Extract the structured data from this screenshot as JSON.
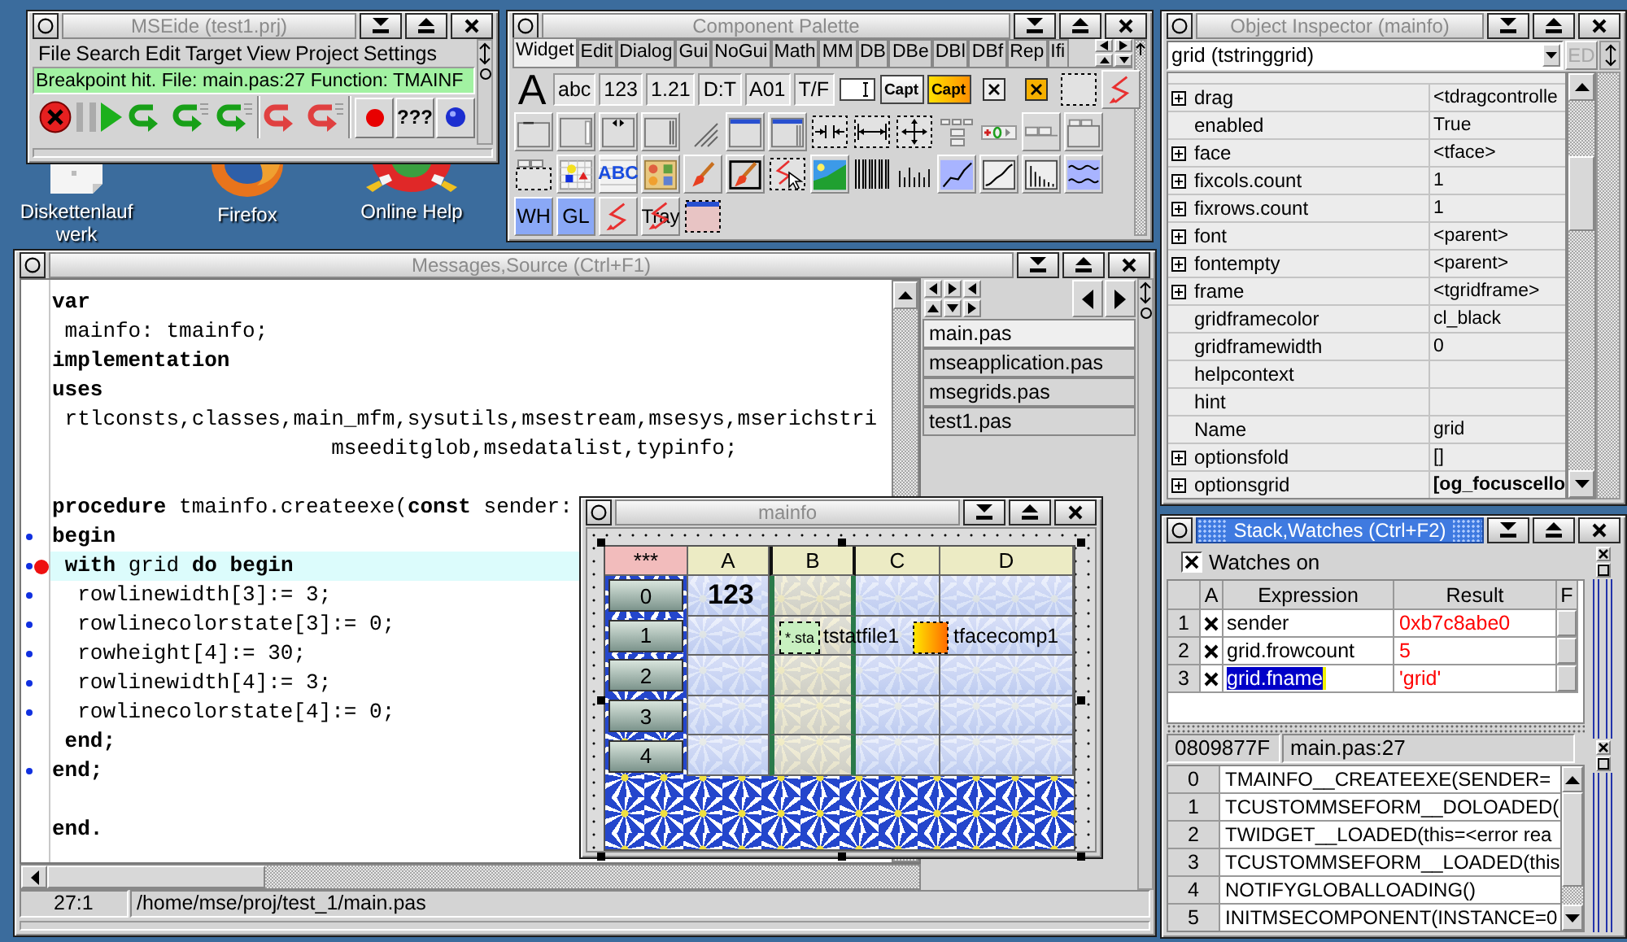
{
  "desktop_icons": [
    {
      "kind": "floppy",
      "label": "Diskettenlaufwerk"
    },
    {
      "kind": "browser",
      "label": "Firefox"
    },
    {
      "kind": "help",
      "label": "Online Help"
    }
  ],
  "ide_window": {
    "title": "MSEide (test1.prj)",
    "active": false,
    "menu": [
      "File",
      "Search",
      "Edit",
      "Target",
      "View",
      "Project",
      "Settings"
    ],
    "status": "Breakpoint hit. File: main.pas:27 Function: TMAINF",
    "toolbar_groups": [
      {
        "kind": "plain",
        "buttons": [
          {
            "kind": "stop",
            "disabled": false
          },
          {
            "kind": "pause",
            "disabled": true
          },
          {
            "kind": "run",
            "disabled": false
          },
          {
            "kind": "next",
            "disabled": false
          },
          {
            "kind": "step",
            "disabled": false
          },
          {
            "kind": "finish",
            "disabled": false
          }
        ]
      },
      {
        "kind": "plain",
        "buttons": [
          {
            "kind": "back",
            "disabled": false
          },
          {
            "kind": "reset",
            "disabled": false
          }
        ]
      },
      {
        "kind": "boxed",
        "buttons": [
          {
            "kind": "dot",
            "disabled": false
          },
          {
            "kind": "text",
            "label": "???",
            "disabled": false
          },
          {
            "kind": "ball",
            "disabled": false
          }
        ]
      }
    ]
  },
  "palette_window": {
    "title": "Component Palette",
    "active": false,
    "tabs": [
      {
        "label": "Widget",
        "selected": true
      },
      {
        "label": "Edit",
        "selected": false
      },
      {
        "label": "Dialog",
        "selected": false
      },
      {
        "label": "Gui",
        "selected": false
      },
      {
        "label": "NoGui",
        "selected": false
      },
      {
        "label": "Math",
        "selected": false
      },
      {
        "label": "MM",
        "selected": false
      },
      {
        "label": "DB",
        "selected": false
      },
      {
        "label": "DBe",
        "selected": false
      },
      {
        "label": "DBl",
        "selected": false
      },
      {
        "label": "DBf",
        "selected": false
      },
      {
        "label": "Rep",
        "selected": false
      },
      {
        "label": "Ifi",
        "selected": false
      }
    ],
    "component_rows": [
      [
        {
          "kind": "letter",
          "label": "A"
        },
        {
          "kind": "text",
          "label": "abc"
        },
        {
          "kind": "text",
          "label": "123"
        },
        {
          "kind": "text",
          "label": "1.21"
        },
        {
          "kind": "text",
          "label": "D:T"
        },
        {
          "kind": "text",
          "label": "A01"
        },
        {
          "kind": "text",
          "label": "T/F"
        },
        {
          "kind": "edit"
        },
        {
          "kind": "button",
          "label": "Capt"
        },
        {
          "kind": "buttoncolored",
          "label": "Capt"
        },
        {
          "kind": "check"
        },
        {
          "kind": "checkcolored"
        },
        {
          "kind": "dashed"
        },
        {
          "kind": "lightning"
        }
      ],
      [
        {
          "kind": "groupbox"
        },
        {
          "kind": "scrollbox"
        },
        {
          "kind": "splitter"
        },
        {
          "kind": "scrollbar"
        },
        {
          "kind": "sizegrip"
        },
        {
          "kind": "form"
        },
        {
          "kind": "scrollform"
        },
        {
          "kind": "spacer"
        },
        {
          "kind": "stretch"
        },
        {
          "kind": "layout"
        },
        {
          "kind": "buttons"
        },
        {
          "kind": "stepper"
        },
        {
          "kind": "tabbar"
        },
        {
          "kind": "tabwidget"
        }
      ],
      [
        {
          "kind": "dashedtabs"
        },
        {
          "kind": "shapesgrid"
        },
        {
          "kind": "textgrid",
          "label": "ABC"
        },
        {
          "kind": "apptiles"
        },
        {
          "kind": "brush"
        },
        {
          "kind": "framedbrush"
        },
        {
          "kind": "pointer"
        },
        {
          "kind": "landscape"
        },
        {
          "kind": "barcode"
        },
        {
          "kind": "ticks"
        },
        {
          "kind": "linechart"
        },
        {
          "kind": "curve"
        },
        {
          "kind": "barchart"
        },
        {
          "kind": "waves"
        }
      ],
      [
        {
          "kind": "tile",
          "label": "WH"
        },
        {
          "kind": "tile",
          "label": "GL"
        },
        {
          "kind": "lightning"
        },
        {
          "kind": "tray",
          "label": "Tray"
        },
        {
          "kind": "pinkform"
        }
      ]
    ]
  },
  "inspector_window": {
    "title": "Object Inspector (mainfo)",
    "active": false,
    "selector": "grid (tstringgrid)",
    "editor_button": {
      "label": "ED",
      "disabled": true
    },
    "rows": [
      {
        "name": "drag",
        "value": "<tdragcontrolle",
        "expandable": true,
        "modified": false
      },
      {
        "name": "enabled",
        "value": "True",
        "expandable": false,
        "modified": false
      },
      {
        "name": "face",
        "value": "<tface>",
        "expandable": true,
        "modified": false
      },
      {
        "name": "fixcols.count",
        "value": "1",
        "expandable": true,
        "modified": false
      },
      {
        "name": "fixrows.count",
        "value": "1",
        "expandable": true,
        "modified": false
      },
      {
        "name": "font",
        "value": "<parent>",
        "expandable": true,
        "modified": false
      },
      {
        "name": "fontempty",
        "value": "<parent>",
        "expandable": true,
        "modified": false
      },
      {
        "name": "frame",
        "value": "<tgridframe>",
        "expandable": true,
        "modified": false
      },
      {
        "name": "gridframecolor",
        "value": "cl_black",
        "expandable": false,
        "modified": false
      },
      {
        "name": "gridframewidth",
        "value": "0",
        "expandable": false,
        "modified": false
      },
      {
        "name": "helpcontext",
        "expandable": false,
        "modified": false
      },
      {
        "name": "hint",
        "expandable": false,
        "modified": false
      },
      {
        "name": "Name",
        "value": "grid",
        "expandable": false,
        "modified": false
      },
      {
        "name": "optionsfold",
        "value": "[]",
        "expandable": true,
        "modified": false
      },
      {
        "name": "optionsgrid",
        "value": "[og_focuscello",
        "expandable": true,
        "modified": true
      }
    ]
  },
  "source_window": {
    "title": "Messages,Source (Ctrl+F1)",
    "active": false,
    "lines": [
      {
        "kind": "code",
        "text": "var",
        "bold": true,
        "executable": false,
        "breakpoint": false,
        "current": false
      },
      {
        "kind": "code",
        "text": " mainfo: tmainfo;",
        "bold": false,
        "executable": false,
        "breakpoint": false,
        "current": false
      },
      {
        "kind": "code",
        "text": "implementation",
        "bold": true,
        "executable": false,
        "breakpoint": false,
        "current": false
      },
      {
        "kind": "code",
        "text": "uses",
        "bold": true,
        "executable": false,
        "breakpoint": false,
        "current": false
      },
      {
        "kind": "code",
        "text": " rtlconsts,classes,main_mfm,sysutils,msestream,msesys,mserichstri",
        "bold": false,
        "executable": false,
        "breakpoint": false,
        "current": false
      },
      {
        "kind": "code",
        "text": "                      mseeditglob,msedatalist,typinfo;",
        "bold": false,
        "executable": false,
        "breakpoint": false,
        "current": false
      },
      {
        "kind": "blank",
        "executable": false,
        "breakpoint": false,
        "current": false
      },
      {
        "kind": "code",
        "text": "**procedure** tmainfo.createexe(**const** sender:",
        "bold": false,
        "executable": false,
        "breakpoint": false,
        "current": false
      },
      {
        "kind": "code",
        "text": "begin",
        "bold": true,
        "executable": true,
        "breakpoint": false,
        "current": false
      },
      {
        "kind": "code",
        "text": " **with** grid **do** **begin**",
        "bold": false,
        "executable": true,
        "breakpoint": true,
        "current": true
      },
      {
        "kind": "code",
        "text": "  rowlinewidth[3]:= 3;",
        "bold": false,
        "executable": true,
        "breakpoint": false,
        "current": false
      },
      {
        "kind": "code",
        "text": "  rowlinecolorstate[3]:= 0;",
        "bold": false,
        "executable": true,
        "breakpoint": false,
        "current": false
      },
      {
        "kind": "code",
        "text": "  rowheight[4]:= 30;",
        "bold": false,
        "executable": true,
        "breakpoint": false,
        "current": false
      },
      {
        "kind": "code",
        "text": "  rowlinewidth[4]:= 3;",
        "bold": false,
        "executable": true,
        "breakpoint": false,
        "current": false
      },
      {
        "kind": "code",
        "text": "  rowlinecolorstate[4]:= 0;",
        "bold": false,
        "executable": true,
        "breakpoint": false,
        "current": false
      },
      {
        "kind": "code",
        "text": " end;",
        "bold": true,
        "executable": false,
        "breakpoint": false,
        "current": false
      },
      {
        "kind": "code",
        "text": "end;",
        "bold": true,
        "executable": true,
        "breakpoint": false,
        "current": false
      },
      {
        "kind": "blank",
        "executable": false,
        "breakpoint": false,
        "current": false
      },
      {
        "kind": "code",
        "text": "end.",
        "bold": true,
        "executable": false,
        "breakpoint": false,
        "current": false
      }
    ],
    "file_tabs": [
      {
        "label": "main.pas",
        "selected": true
      },
      {
        "label": "mseapplication.pas",
        "selected": false
      },
      {
        "label": "msegrids.pas",
        "selected": false
      },
      {
        "label": "test1.pas",
        "selected": false
      }
    ],
    "cursor": "27:1",
    "path": "/home/mse/proj/test_1/main.pas"
  },
  "mainfo_window": {
    "title": "mainfo",
    "active": false,
    "grid": {
      "corner": "***",
      "columns": [
        {
          "label": "A",
          "thick_border": false
        },
        {
          "label": "B",
          "thick_border": true
        },
        {
          "label": "C",
          "thick_border": false
        },
        {
          "label": "D",
          "thick_border": false
        }
      ],
      "rows": [
        {
          "header": "0",
          "cells": [
            "123"
          ]
        },
        {
          "header": "1"
        },
        {
          "header": "2"
        },
        {
          "header": "3"
        },
        {
          "header": "4"
        }
      ]
    },
    "components": [
      {
        "kind": "statfile",
        "icon_text": "*.sta",
        "name": "tstatfile1"
      },
      {
        "kind": "face",
        "name": "tfacecomp1"
      }
    ]
  },
  "stack_window": {
    "title": "Stack,Watches (Ctrl+F2)",
    "active": true,
    "watches_on": {
      "label": "Watches on",
      "checked": true
    },
    "watch_columns": [
      "A",
      "Expression",
      "Result",
      "F"
    ],
    "watches": [
      {
        "index": "1",
        "active": true,
        "expression": "sender",
        "result": "0xb7c8abe0",
        "selected": false
      },
      {
        "index": "2",
        "active": true,
        "expression": "grid.frowcount",
        "result": "5",
        "selected": false
      },
      {
        "index": "3",
        "active": true,
        "expression": "grid.fname",
        "result": "'grid'",
        "selected": true
      }
    ],
    "address": "0809877F",
    "location": "main.pas:27",
    "frames": [
      {
        "index": "0",
        "call": "TMAINFO__CREATEEXE(SENDER="
      },
      {
        "index": "1",
        "call": "TCUSTOMMSEFORM__DOLOADED("
      },
      {
        "index": "2",
        "call": "TWIDGET__LOADED(this=<error rea"
      },
      {
        "index": "3",
        "call": "TCUSTOMMSEFORM__LOADED(this"
      },
      {
        "index": "4",
        "call": "NOTIFYGLOBALLOADING()"
      },
      {
        "index": "5",
        "call": "INITMSECOMPONENT(INSTANCE=0"
      }
    ]
  }
}
